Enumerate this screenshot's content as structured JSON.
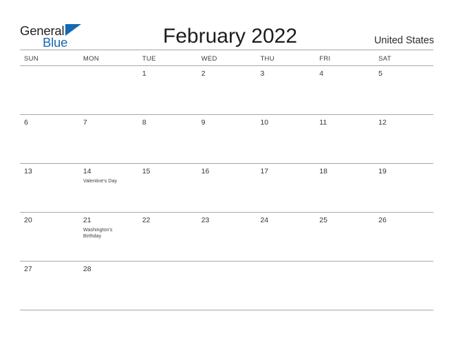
{
  "brand": {
    "name_top": "General",
    "name_bottom": "Blue",
    "accent_color": "#1668b3",
    "text_color": "#231f20"
  },
  "header": {
    "title": "February 2022",
    "country": "United States"
  },
  "calendar": {
    "month": "February",
    "year": "2022",
    "weekday_headers": [
      "SUN",
      "MON",
      "TUE",
      "WED",
      "THU",
      "FRI",
      "SAT"
    ],
    "weeks": [
      [
        {
          "date": ""
        },
        {
          "date": ""
        },
        {
          "date": "1"
        },
        {
          "date": "2"
        },
        {
          "date": "3"
        },
        {
          "date": "4"
        },
        {
          "date": "5"
        }
      ],
      [
        {
          "date": "6"
        },
        {
          "date": "7"
        },
        {
          "date": "8"
        },
        {
          "date": "9"
        },
        {
          "date": "10"
        },
        {
          "date": "11"
        },
        {
          "date": "12"
        }
      ],
      [
        {
          "date": "13"
        },
        {
          "date": "14",
          "event": "Valentine's Day"
        },
        {
          "date": "15"
        },
        {
          "date": "16"
        },
        {
          "date": "17"
        },
        {
          "date": "18"
        },
        {
          "date": "19"
        }
      ],
      [
        {
          "date": "20"
        },
        {
          "date": "21",
          "event": "Washington's Birthday"
        },
        {
          "date": "22"
        },
        {
          "date": "23"
        },
        {
          "date": "24"
        },
        {
          "date": "25"
        },
        {
          "date": "26"
        }
      ],
      [
        {
          "date": "27"
        },
        {
          "date": "28"
        },
        {
          "date": ""
        },
        {
          "date": ""
        },
        {
          "date": ""
        },
        {
          "date": ""
        },
        {
          "date": ""
        }
      ]
    ]
  }
}
